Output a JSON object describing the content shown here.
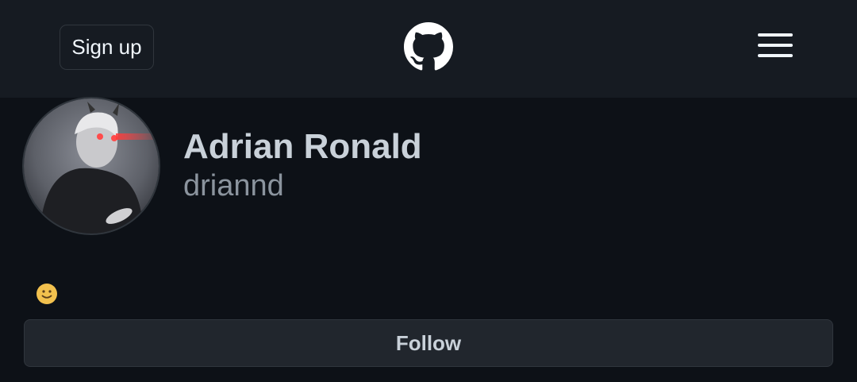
{
  "header": {
    "signup_label": "Sign up",
    "logo_icon": "github-mark-icon",
    "menu_icon": "hamburger-menu-icon"
  },
  "profile": {
    "avatar_icon": "user-avatar",
    "display_name": "Adrian Ronald",
    "username": "driannd",
    "status_emoji": "slightly-smiling-face-icon"
  },
  "actions": {
    "follow_label": "Follow"
  },
  "colors": {
    "page_bg": "#0d1117",
    "header_bg": "#161b22",
    "button_bg": "#21262d",
    "border": "#30363d",
    "primary_text": "#c9d1d9",
    "muted_text": "#8b949e"
  }
}
